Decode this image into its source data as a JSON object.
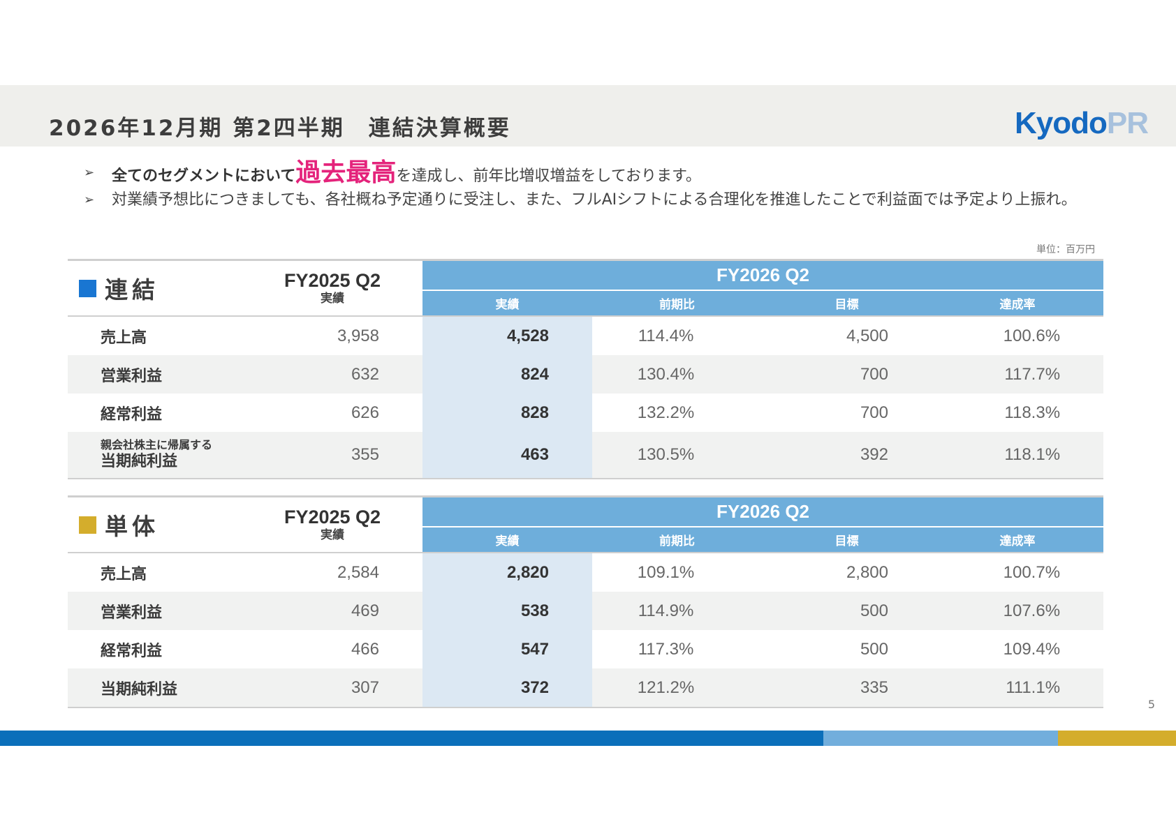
{
  "header": {
    "title": "2026年12月期 第2四半期　連結決算概要",
    "logo_main": "Kyodo",
    "logo_sub": "PR"
  },
  "bullets": {
    "line1_strong": "全てのセグメントにおいて",
    "line1_highlight": "過去最高",
    "line1_rest": "を達成し、前年比増収増益をしております。",
    "line2": "対業績予想比につきましても、各社概ね予定通りに受注し、また、フルAIシフトによる合理化を推進したことで利益面では予定より上振れ。"
  },
  "unit_note": "単位：百万円",
  "columns": {
    "prev_fy": "FY2025 Q2",
    "prev_label": "実績",
    "cur_fy": "FY2026 Q2",
    "actual": "実績",
    "yoy": "前期比",
    "target": "目標",
    "achievement": "達成率"
  },
  "consolidated": {
    "title": "連結",
    "color": "#1976d2",
    "rows": [
      {
        "label": "売上高",
        "prev": "3,958",
        "actual": "4,528",
        "yoy": "114.4%",
        "target": "4,500",
        "achievement": "100.6%"
      },
      {
        "label": "営業利益",
        "prev": "632",
        "actual": "824",
        "yoy": "130.4%",
        "target": "700",
        "achievement": "117.7%"
      },
      {
        "label": "経常利益",
        "prev": "626",
        "actual": "828",
        "yoy": "132.2%",
        "target": "700",
        "achievement": "118.3%"
      },
      {
        "label_small": "親会社株主に帰属する",
        "label": "当期純利益",
        "prev": "355",
        "actual": "463",
        "yoy": "130.5%",
        "target": "392",
        "achievement": "118.1%"
      }
    ]
  },
  "standalone": {
    "title": "単体",
    "color": "#d4ad2c",
    "rows": [
      {
        "label": "売上高",
        "prev": "2,584",
        "actual": "2,820",
        "yoy": "109.1%",
        "target": "2,800",
        "achievement": "100.7%"
      },
      {
        "label": "営業利益",
        "prev": "469",
        "actual": "538",
        "yoy": "114.9%",
        "target": "500",
        "achievement": "107.6%"
      },
      {
        "label": "経常利益",
        "prev": "466",
        "actual": "547",
        "yoy": "117.3%",
        "target": "500",
        "achievement": "109.4%"
      },
      {
        "label": "当期純利益",
        "prev": "307",
        "actual": "372",
        "yoy": "121.2%",
        "target": "335",
        "achievement": "111.1%"
      }
    ]
  },
  "page_number": "5",
  "footer_colors": [
    "#0b6fba",
    "#72aedc",
    "#d4ad2c"
  ]
}
